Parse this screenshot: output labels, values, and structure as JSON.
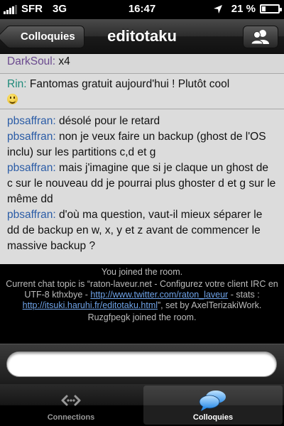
{
  "status_bar": {
    "carrier": "SFR",
    "network": "3G",
    "time": "16:47",
    "battery_percent": "21 %",
    "battery_level": 0.21
  },
  "nav": {
    "back_label": "Colloquies",
    "title": "editotaku"
  },
  "messages": [
    {
      "nick": "DarkSoul:",
      "text": " x4"
    },
    {
      "nick": "Rin:",
      "text": " Fantomas gratuit aujourd'hui ! Plutôt cool"
    },
    {
      "nick": "pbsaffran:",
      "text": " désolé pour le retard"
    },
    {
      "nick": "pbsaffran:",
      "text": " non je veux faire un backup (ghost de l'OS inclu) sur les partitions c,d et g"
    },
    {
      "nick": "pbsaffran:",
      "text": " mais j'imagine que si je claque un ghost de c sur le nouveau dd je pourrai plus ghoster d et g sur le même dd"
    },
    {
      "nick": "pbsaffran:",
      "text": " d'où ma question, vaut-il mieux séparer le dd de backup en w, x, y et z avant de commencer le massive backup ?"
    }
  ],
  "system": {
    "joined": "You joined the room.",
    "topic_pre": "Current chat topic is “raton-laveur.net - Configurez votre client IRC en UTF-8 kthxbye - ",
    "topic_link1": "http://www.twitter.com/raton_laveur",
    "topic_mid": " - stats : ",
    "topic_link2": "http://itsuki.haruhi.fr/editotaku.html",
    "topic_post": "”, set by AxelTerizakiWork.",
    "user_joined": "Ruzgfpegk joined the room."
  },
  "input": {
    "value": ""
  },
  "tabs": [
    {
      "label": "Connections",
      "icon": "connections-icon"
    },
    {
      "label": "Colloquies",
      "icon": "chat-bubbles-icon"
    }
  ]
}
